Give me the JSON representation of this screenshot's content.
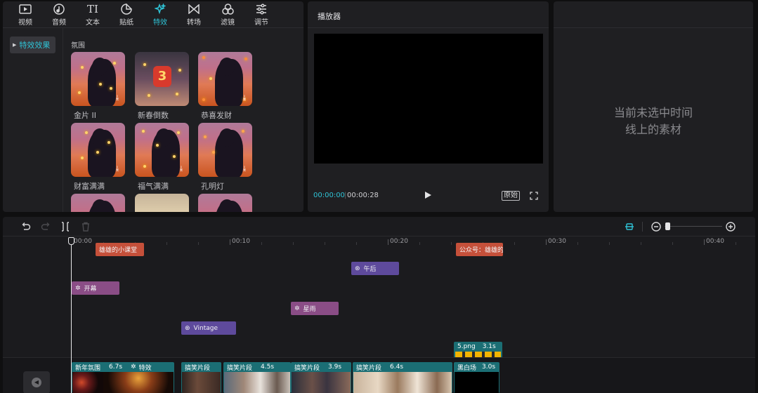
{
  "toolbar": {
    "tabs": [
      {
        "label": "视频",
        "icon": "video-icon"
      },
      {
        "label": "音频",
        "icon": "music-icon"
      },
      {
        "label": "文本",
        "icon": "text-icon"
      },
      {
        "label": "贴纸",
        "icon": "sticker-icon"
      },
      {
        "label": "特效",
        "icon": "sparkle-icon",
        "active": true
      },
      {
        "label": "转场",
        "icon": "transition-icon"
      },
      {
        "label": "滤镜",
        "icon": "filter-icon"
      },
      {
        "label": "调节",
        "icon": "sliders-icon"
      }
    ],
    "accent_color": "#2fc3d6"
  },
  "sidebar": {
    "items": [
      {
        "label": "特效效果",
        "selected": true
      }
    ]
  },
  "effects": {
    "section_title": "氛围",
    "items": [
      {
        "label": "金片 II"
      },
      {
        "label": "新春倒数"
      },
      {
        "label": "恭喜发财"
      },
      {
        "label": "财富满满"
      },
      {
        "label": "福气满满"
      },
      {
        "label": "孔明灯"
      },
      {
        "label": ""
      },
      {
        "label": ""
      },
      {
        "label": ""
      }
    ]
  },
  "player": {
    "title": "播放器",
    "current_time": "00:00:00",
    "total_time": "00:00:28",
    "ratio_label": "原始"
  },
  "properties": {
    "empty_line1": "当前未选中时间",
    "empty_line2": "线上的素材"
  },
  "timeline": {
    "ruler": [
      "00:00",
      "00:10",
      "00:20",
      "00:30",
      "00:40"
    ],
    "text_clips": [
      {
        "label": "雄雄的小课堂"
      },
      {
        "label": "公众号：雄雄的小"
      }
    ],
    "filter_clips": [
      {
        "label": "午后"
      },
      {
        "label": "Vintage"
      }
    ],
    "effect_clips": [
      {
        "label": "开幕"
      },
      {
        "label": "星雨"
      }
    ],
    "sticker_clip": {
      "label": "5.png",
      "duration": "3.1s"
    },
    "video_clips": [
      {
        "label": "新年氛围",
        "duration": "6.7s",
        "fx": "特效"
      },
      {
        "label": "搞笑片段",
        "duration": ""
      },
      {
        "label": "搞笑片段",
        "duration": "4.5s"
      },
      {
        "label": "搞笑片段",
        "duration": "3.9s"
      },
      {
        "label": "搞笑片段",
        "duration": "6.4s"
      },
      {
        "label": "黑白场",
        "duration": "3.0s"
      }
    ]
  }
}
